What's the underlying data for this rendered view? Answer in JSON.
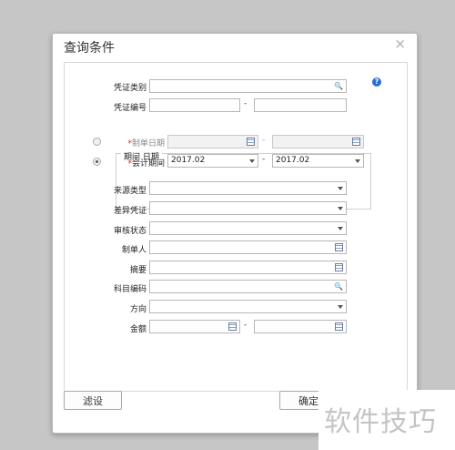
{
  "dialog": {
    "title": "查询条件",
    "close_glyph": "×",
    "help_glyph": "?"
  },
  "fields": {
    "voucher_type": {
      "label": "凭证类别",
      "value": ""
    },
    "voucher_no": {
      "label": "凭证编号",
      "from": "",
      "to": "",
      "separator": "-"
    },
    "period": {
      "legend": "期间 日期",
      "create_date": {
        "label": "制单日期",
        "required_mark": "*",
        "from": "",
        "to": "",
        "separator": "-",
        "selected": false
      },
      "fiscal_period": {
        "label": "会计期间",
        "required_mark": "*",
        "from": "2017.02",
        "to": "2017.02",
        "separator": "-",
        "selected": true
      }
    },
    "source_type": {
      "label": "来源类型",
      "value": ""
    },
    "diff_voucher": {
      "label": "差异凭证",
      "value": ""
    },
    "audit_status": {
      "label": "审核状态",
      "value": ""
    },
    "creator": {
      "label": "制单人",
      "value": ""
    },
    "summary": {
      "label": "摘要",
      "value": ""
    },
    "account_code": {
      "label": "科目编码",
      "value": ""
    },
    "direction": {
      "label": "方向",
      "value": ""
    },
    "amount": {
      "label": "金额",
      "from": "",
      "to": "",
      "separator": "-"
    }
  },
  "buttons": {
    "filter": "滤设",
    "ok": "确定"
  },
  "watermark": "软件技巧",
  "icons": [
    "search-icon",
    "calendar-icon",
    "dropdown-icon",
    "selector-icon",
    "help-icon",
    "close-icon"
  ],
  "colors": {
    "required": "#e02020",
    "help": "#2b6ed6"
  }
}
